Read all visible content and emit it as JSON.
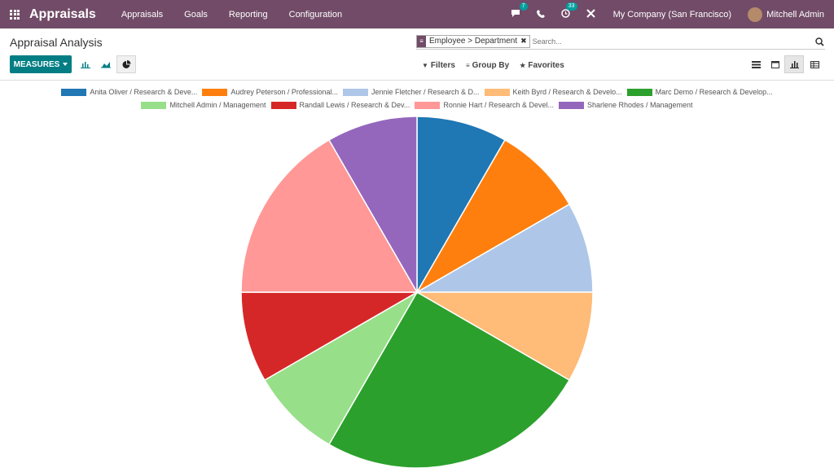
{
  "navbar": {
    "brand": "Appraisals",
    "menu": [
      "Appraisals",
      "Goals",
      "Reporting",
      "Configuration"
    ],
    "messages_count": "7",
    "activities_count": "33",
    "company": "My Company (San Francisco)",
    "user": "Mitchell Admin"
  },
  "control": {
    "title": "Appraisal Analysis",
    "facet": "Employee > Department",
    "search_placeholder": "Search...",
    "measures_label": "MEASURES",
    "filters_label": "Filters",
    "groupby_label": "Group By",
    "favorites_label": "Favorites"
  },
  "chart_data": {
    "type": "pie",
    "title": "",
    "legend_position": "top",
    "series": [
      {
        "name": "Anita Oliver / Research & Deve...",
        "value": 1,
        "color": "#1f77b4"
      },
      {
        "name": "Audrey Peterson / Professional...",
        "value": 1,
        "color": "#ff7f0e"
      },
      {
        "name": "Jennie Fletcher / Research & D...",
        "value": 1,
        "color": "#aec7e8"
      },
      {
        "name": "Keith Byrd / Research & Develo...",
        "value": 1,
        "color": "#ffbb78"
      },
      {
        "name": "Marc Demo / Research & Develop...",
        "value": 3,
        "color": "#2ca02c"
      },
      {
        "name": "Mitchell Admin / Management",
        "value": 1,
        "color": "#98df8a"
      },
      {
        "name": "Randall Lewis / Research & Dev...",
        "value": 1,
        "color": "#d62728"
      },
      {
        "name": "Ronnie Hart / Research & Devel...",
        "value": 2,
        "color": "#ff9896"
      },
      {
        "name": "Sharlene Rhodes / Management",
        "value": 1,
        "color": "#9467bd"
      }
    ]
  }
}
